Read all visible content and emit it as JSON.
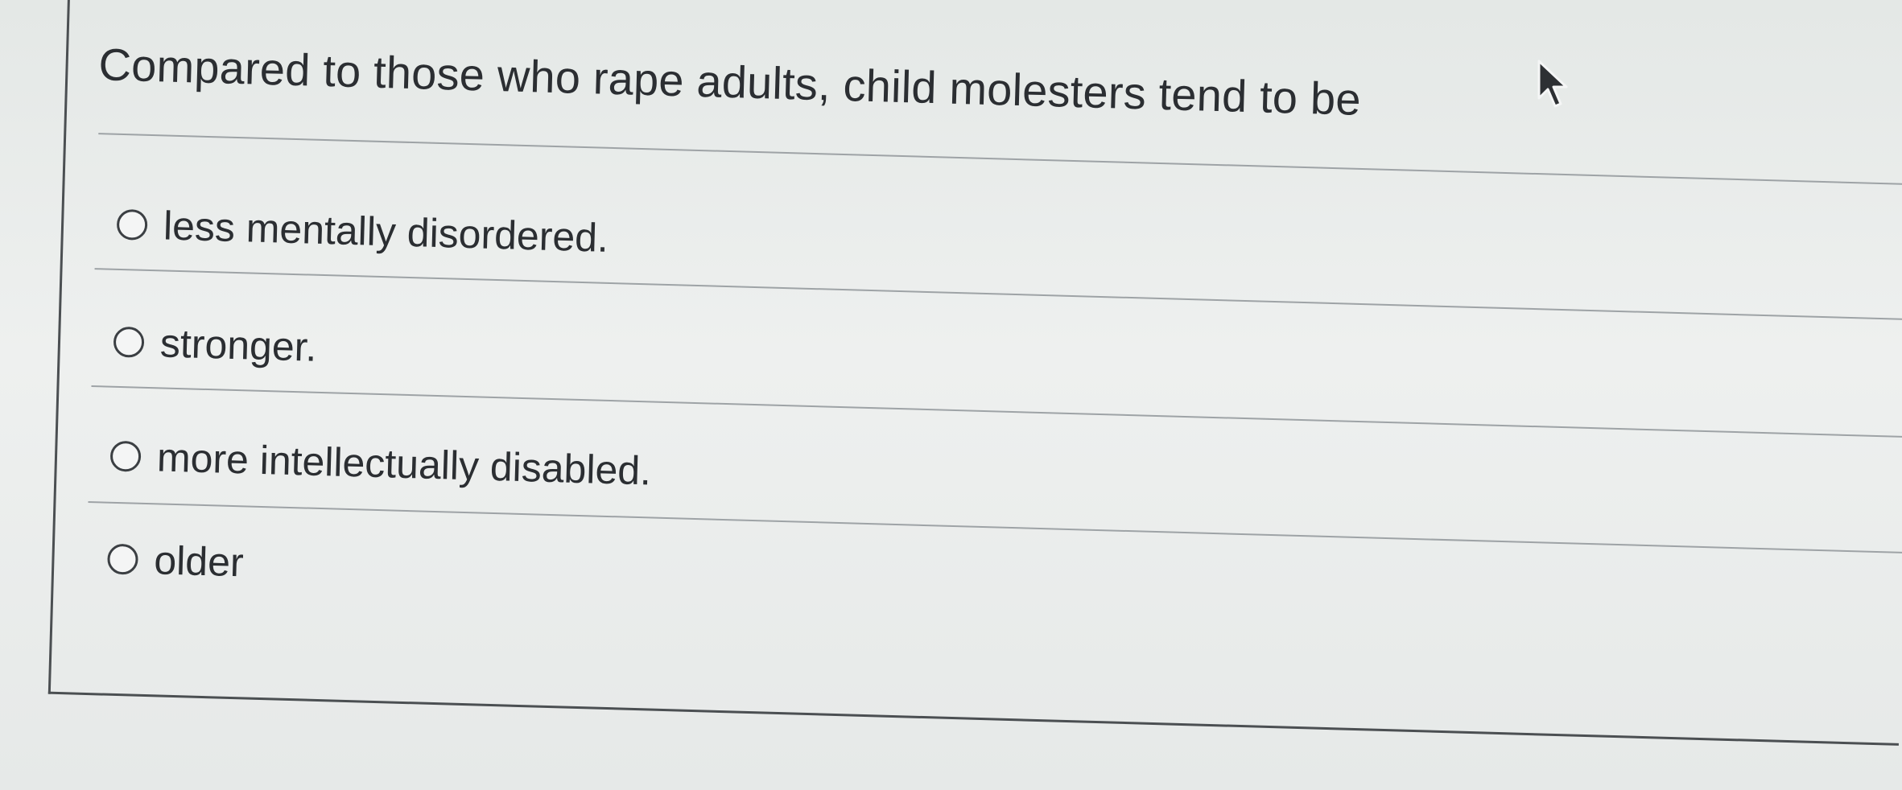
{
  "question": {
    "text": "Compared to those who rape adults, child molesters tend to be"
  },
  "options": [
    {
      "label": "less mentally disordered.",
      "selected": false
    },
    {
      "label": "stronger.",
      "selected": false
    },
    {
      "label": "more intellectually disabled.",
      "selected": false
    },
    {
      "label": "older",
      "selected": false
    }
  ],
  "icons": {
    "cursor": "mouse-pointer-icon",
    "radio": "radio-button-unselected"
  }
}
